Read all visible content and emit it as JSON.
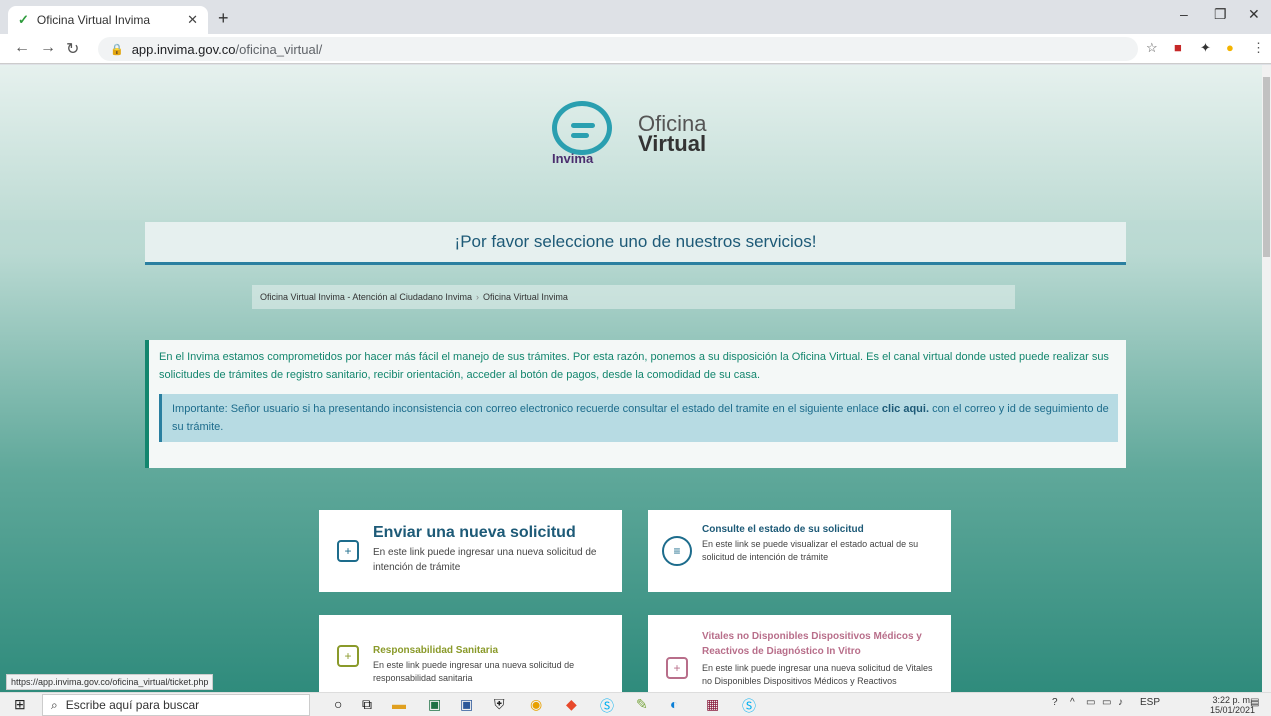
{
  "browser": {
    "tab_title": "Oficina Virtual Invima",
    "url_domain": "app.invima.gov.co",
    "url_path": "/oficina_virtual/",
    "status_url": "https://app.invima.gov.co/oficina_virtual/ticket.php"
  },
  "logo": {
    "brand": "Invima",
    "line1": "Oficina",
    "line2": "Virtual"
  },
  "banner": {
    "title": "¡Por favor seleccione uno de nuestros servicios!"
  },
  "breadcrumb": {
    "item1": "Oficina Virtual Invima - Atención al Ciudadano Invima",
    "item2": "Oficina Virtual Invima"
  },
  "info": {
    "text": "En el Invima estamos comprometidos por hacer más fácil el manejo de sus trámites. Por esta razón, ponemos a su disposición la Oficina Virtual. Es el canal virtual donde usted puede realizar sus solicitudes de trámites de registro sanitario, recibir orientación, acceder al botón de pagos, desde la comodidad de su casa.",
    "alert_before": "Importante: Señor usuario si ha presentando inconsistencia con correo electronico recuerde consultar el estado del tramite en el siguiente enlace",
    "alert_link": "clic aqui.",
    "alert_after": "con el correo y id de seguimiento de su trámite."
  },
  "cards": [
    {
      "title": "Enviar una nueva solicitud",
      "desc": "En este link puede ingresar una nueva solicitud de intención de trámite"
    },
    {
      "title": "Consulte el estado de su solicitud",
      "desc": "En este link se puede visualizar el estado actual de su solicitud de intención de trámite"
    },
    {
      "title": "Responsabilidad Sanitaria",
      "desc": "En este link puede ingresar una nueva solicitud de responsabilidad sanitaria"
    },
    {
      "title": "Vitales no Disponibles Dispositivos Médicos y Reactivos de Diagnóstico In Vitro",
      "desc": "En este link puede ingresar una nueva solicitud de Vitales no Disponibles Dispositivos Médicos y Reactivos"
    }
  ],
  "taskbar": {
    "search_placeholder": "Escribe aquí para buscar",
    "lang": "ESP",
    "time": "3:22 p. m.",
    "date": "15/01/2021"
  }
}
